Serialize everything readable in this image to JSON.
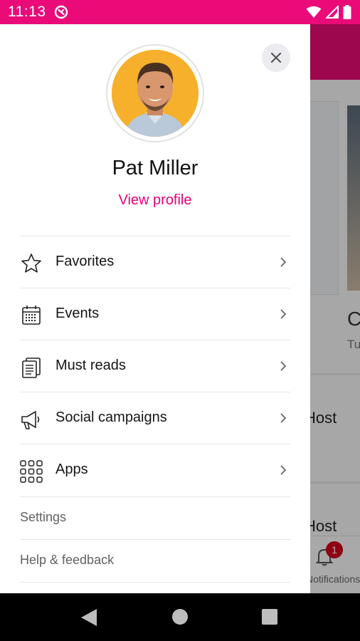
{
  "status_bar": {
    "time": "11:13",
    "icons": [
      "app-notification-icon",
      "wifi-icon",
      "cell-signal-icon",
      "battery-icon"
    ]
  },
  "background": {
    "partial_title_letter": "C",
    "partial_subtitle": "Tu",
    "partial_host_1": "Host",
    "partial_host_2": "Host",
    "notifications_badge": "1",
    "notifications_label": "Notifications"
  },
  "drawer": {
    "profile": {
      "name": "Pat Miller",
      "view_profile_label": "View profile"
    },
    "menu_items": [
      {
        "label": "Favorites",
        "icon": "star-icon"
      },
      {
        "label": "Events",
        "icon": "calendar-icon"
      },
      {
        "label": "Must reads",
        "icon": "documents-icon"
      },
      {
        "label": "Social campaigns",
        "icon": "megaphone-icon"
      },
      {
        "label": "Apps",
        "icon": "apps-grid-icon"
      }
    ],
    "secondary_items": [
      {
        "label": "Settings"
      },
      {
        "label": "Help & feedback"
      }
    ]
  },
  "colors": {
    "accent": "#e6007a",
    "status_bar": "#ea0a78"
  }
}
